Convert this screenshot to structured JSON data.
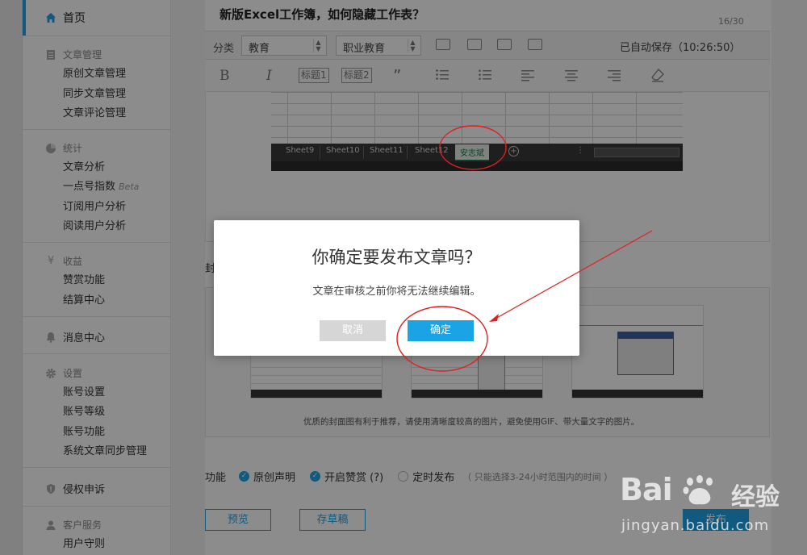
{
  "sidebar": {
    "home": "首页",
    "article_mgmt": {
      "title": "文章管理",
      "items": [
        "原创文章管理",
        "同步文章管理",
        "文章评论管理"
      ]
    },
    "stats": {
      "title": "统计",
      "items": [
        "文章分析",
        "一点号指数",
        "订阅用户分析",
        "阅读用户分析"
      ],
      "beta": "Beta"
    },
    "income": {
      "title": "收益",
      "items": [
        "赞赏功能",
        "结算中心"
      ]
    },
    "messages": "消息中心",
    "settings": {
      "title": "设置",
      "items": [
        "账号设置",
        "账号等级",
        "账号功能",
        "系统文章同步管理"
      ]
    },
    "rights": "侵权申诉",
    "service": {
      "title": "客户服务",
      "items": [
        "用户守则"
      ]
    }
  },
  "article": {
    "title": "新版Excel工作簿，如何隐藏工作表？",
    "counter": "16/30"
  },
  "toolbar": {
    "category_label": "分类",
    "category1": "教育",
    "category2": "职业教育",
    "autosave": "已自动保存（10:26:50）",
    "bold": "B",
    "italic": "I",
    "h1": "标题1",
    "h2": "标题2",
    "quote": "”"
  },
  "excel": {
    "sheets": [
      "Sheet9",
      "Sheet10",
      "Sheet11",
      "Sheet12"
    ],
    "active_sheet": "安志斌",
    "add_symbol": "+"
  },
  "cover": {
    "label": "封",
    "tip": "优质的封面图有利于推荐，请使用清晰度较高的图片，避免使用GIF、带大量文字的图片。"
  },
  "functions": {
    "label": "功能",
    "original": "原创声明",
    "reward": "开启赞赏 (?)",
    "schedule": "定时发布",
    "schedule_note": "（ 只能选择3-24小时范围内的时间 ）"
  },
  "buttons": {
    "preview": "预览",
    "draft": "存草稿",
    "publish": "发布"
  },
  "modal": {
    "title": "你确定要发布文章吗？",
    "message": "文章在审核之前你将无法继续编辑。",
    "cancel": "取消",
    "confirm": "确定"
  },
  "colors": {
    "accent": "#1fa3e6",
    "annotation": "#e02020"
  },
  "watermark": {
    "logo": "Bai",
    "logo_cn": "经验",
    "url": "jingyan.baidu.com"
  }
}
